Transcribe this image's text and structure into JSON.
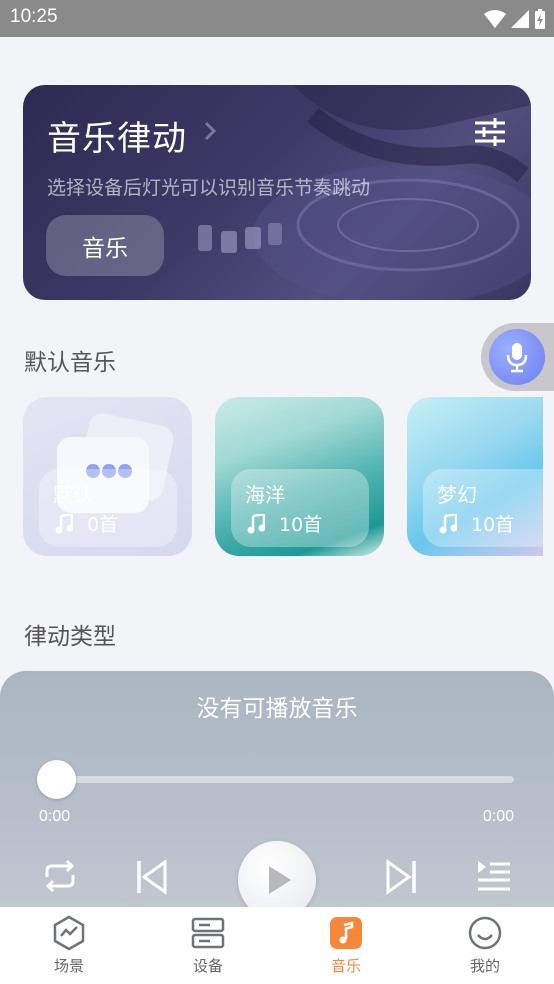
{
  "status_bar": {
    "time": "10:25"
  },
  "banner": {
    "title": "音乐律动",
    "subtitle": "选择设备后灯光可以识别音乐节奏跳动",
    "button_label": "音乐",
    "settings_icon": "sliders-icon"
  },
  "sections": {
    "default_music": "默认音乐",
    "rhythm_type": "律动类型"
  },
  "playlists": [
    {
      "name": "默认",
      "count": "0首",
      "icon": "music-note-icon"
    },
    {
      "name": "海洋",
      "count": "10首",
      "icon": "music-note-icon"
    },
    {
      "name": "梦幻",
      "count": "10首",
      "icon": "music-note-icon"
    }
  ],
  "player": {
    "title": "没有可播放音乐",
    "time_current": "0:00",
    "time_total": "0:00",
    "progress": 0
  },
  "nav": [
    {
      "label": "场景",
      "icon": "scene-icon",
      "active": false
    },
    {
      "label": "设备",
      "icon": "device-icon",
      "active": false
    },
    {
      "label": "音乐",
      "icon": "music-icon",
      "active": true
    },
    {
      "label": "我的",
      "icon": "profile-icon",
      "active": false
    }
  ],
  "colors": {
    "accent": "#f7873a",
    "banner_bg": "#3e3a68",
    "voice": "#7b8af4"
  }
}
